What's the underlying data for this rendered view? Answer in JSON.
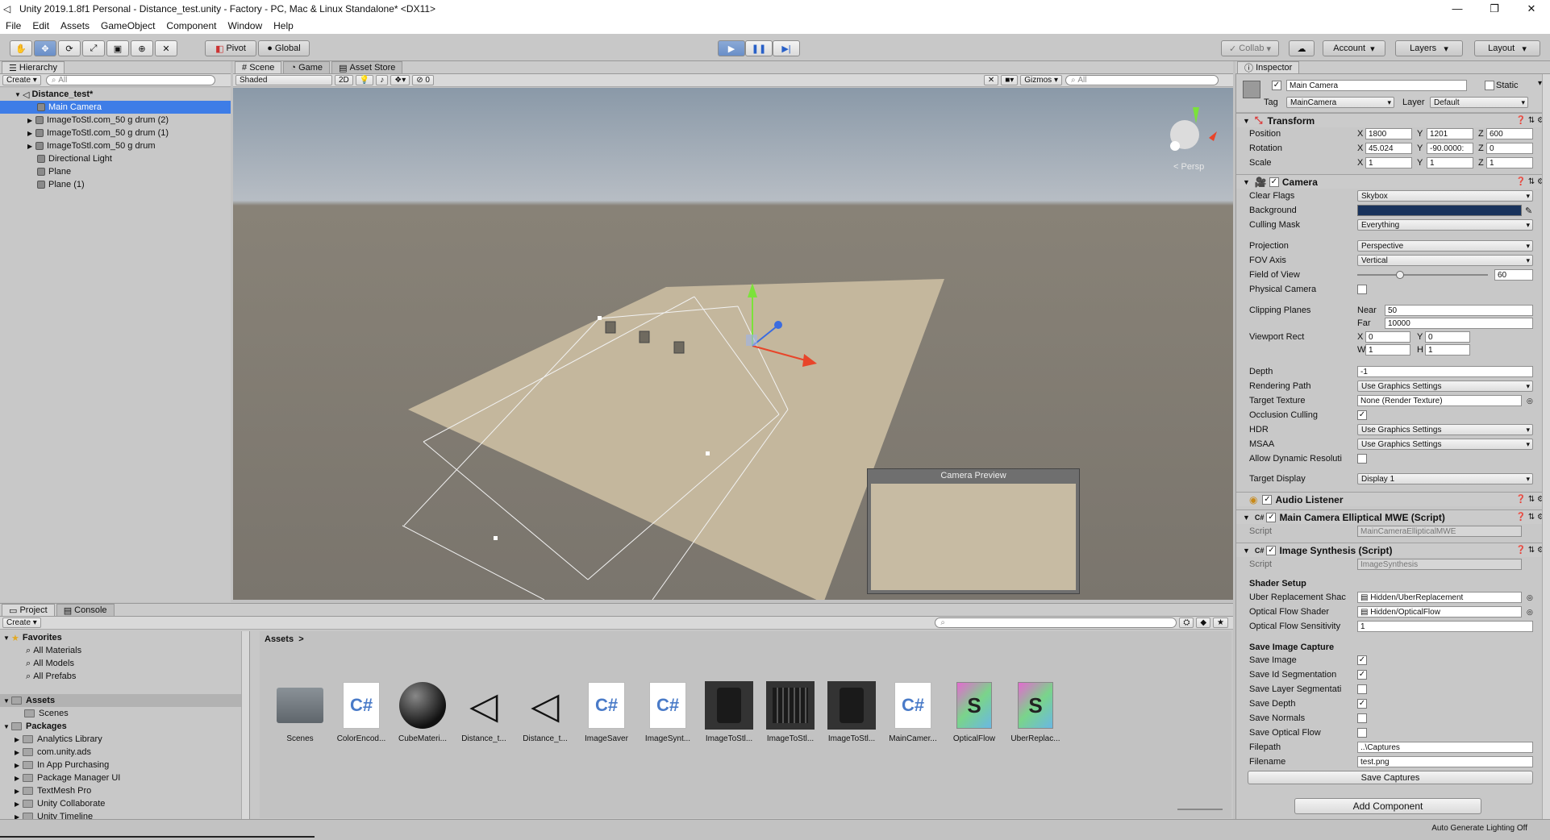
{
  "window": {
    "title": "Unity 2019.1.8f1 Personal - Distance_test.unity - Factory - PC, Mac & Linux Standalone* <DX11>",
    "controls": [
      "—",
      "❐",
      "✕"
    ]
  },
  "menu": [
    "File",
    "Edit",
    "Assets",
    "GameObject",
    "Component",
    "Window",
    "Help"
  ],
  "toolbar": {
    "pivot": "Pivot",
    "global": "Global",
    "collab": "Collab",
    "account": "Account",
    "layers": "Layers",
    "layout": "Layout"
  },
  "hierarchy": {
    "tab": "Hierarchy",
    "create": "Create",
    "search_placeholder": "All",
    "scene_name": "Distance_test*",
    "items": [
      {
        "label": "Main Camera",
        "selected": true,
        "expandable": false
      },
      {
        "label": "ImageToStl.com_50 g drum (2)",
        "selected": false,
        "expandable": true
      },
      {
        "label": "ImageToStl.com_50 g drum (1)",
        "selected": false,
        "expandable": true
      },
      {
        "label": "ImageToStl.com_50 g drum",
        "selected": false,
        "expandable": true
      },
      {
        "label": "Directional Light",
        "selected": false,
        "expandable": false
      },
      {
        "label": "Plane",
        "selected": false,
        "expandable": false
      },
      {
        "label": "Plane (1)",
        "selected": false,
        "expandable": false
      }
    ]
  },
  "scene": {
    "tabs": [
      "Scene",
      "Game",
      "Asset Store"
    ],
    "shading": "Shaded",
    "mode_2d": "2D",
    "fx_count": "0",
    "gizmos": "Gizmos",
    "search_placeholder": "All",
    "persp": "< Persp",
    "camera_preview": "Camera Preview"
  },
  "inspector": {
    "tab": "Inspector",
    "object_name": "Main Camera",
    "static_label": "Static",
    "tag_label": "Tag",
    "tag_value": "MainCamera",
    "layer_label": "Layer",
    "layer_value": "Default",
    "transform": {
      "title": "Transform",
      "position_label": "Position",
      "position": [
        "1800",
        "1201",
        "600"
      ],
      "rotation_label": "Rotation",
      "rotation": [
        "45.024",
        "-90.0000:",
        "0"
      ],
      "scale_label": "Scale",
      "scale": [
        "1",
        "1",
        "1"
      ]
    },
    "camera": {
      "title": "Camera",
      "clear_flags_label": "Clear Flags",
      "clear_flags": "Skybox",
      "background_label": "Background",
      "culling_mask_label": "Culling Mask",
      "culling_mask": "Everything",
      "projection_label": "Projection",
      "projection": "Perspective",
      "fov_axis_label": "FOV Axis",
      "fov_axis": "Vertical",
      "fov_label": "Field of View",
      "fov": "60",
      "fov_slider": 0.33,
      "physical_label": "Physical Camera",
      "clipping_label": "Clipping Planes",
      "near_label": "Near",
      "near": "50",
      "far_label": "Far",
      "far": "10000",
      "viewport_label": "Viewport Rect",
      "vx": "0",
      "vy": "0",
      "vw": "1",
      "vh": "1",
      "depth_label": "Depth",
      "depth": "-1",
      "rendering_path_label": "Rendering Path",
      "rendering_path": "Use Graphics Settings",
      "target_texture_label": "Target Texture",
      "target_texture": "None (Render Texture)",
      "occlusion_label": "Occlusion Culling",
      "hdr_label": "HDR",
      "hdr": "Use Graphics Settings",
      "msaa_label": "MSAA",
      "msaa": "Use Graphics Settings",
      "dyn_res_label": "Allow Dynamic Resoluti",
      "target_display_label": "Target Display",
      "target_display": "Display 1"
    },
    "audio_listener": "Audio Listener",
    "elliptical": {
      "title": "Main Camera Elliptical MWE (Script)",
      "script_label": "Script",
      "script": "MainCameraEllipticalMWE"
    },
    "synthesis": {
      "title": "Image Synthesis (Script)",
      "script_label": "Script",
      "script": "ImageSynthesis",
      "shader_setup": "Shader Setup",
      "uber_label": "Uber Replacement Shac",
      "uber": "Hidden/UberReplacement",
      "optical_label": "Optical Flow Shader",
      "optical": "Hidden/OpticalFlow",
      "sensitivity_label": "Optical Flow Sensitivity",
      "sensitivity": "1",
      "capture": "Save Image Capture",
      "save_image": "Save Image",
      "save_id": "Save Id Segmentation",
      "save_layer": "Save Layer Segmentati",
      "save_depth": "Save Depth",
      "save_normals": "Save Normals",
      "save_optical": "Save Optical Flow",
      "filepath_label": "Filepath",
      "filepath": "..\\Captures",
      "filename_label": "Filename",
      "filename": "test.png",
      "save_captures": "Save Captures"
    },
    "add_component": "Add Component"
  },
  "project": {
    "tabs": [
      "Project",
      "Console"
    ],
    "create": "Create",
    "favorites": "Favorites",
    "fav_items": [
      "All Materials",
      "All Models",
      "All Prefabs"
    ],
    "assets": "Assets",
    "asset_children": [
      "Scenes"
    ],
    "packages": "Packages",
    "package_items": [
      "Analytics Library",
      "com.unity.ads",
      "In App Purchasing",
      "Package Manager UI",
      "TextMesh Pro",
      "Unity Collaborate",
      "Unity Timeline"
    ],
    "breadcrumb": "Assets",
    "grid": [
      {
        "label": "Scenes",
        "kind": "folder"
      },
      {
        "label": "ColorEncod...",
        "kind": "cs"
      },
      {
        "label": "CubeMateri...",
        "kind": "sphere"
      },
      {
        "label": "Distance_t...",
        "kind": "unity"
      },
      {
        "label": "Distance_t...",
        "kind": "unity"
      },
      {
        "label": "ImageSaver",
        "kind": "cs"
      },
      {
        "label": "ImageSynt...",
        "kind": "cs"
      },
      {
        "label": "ImageToStl...",
        "kind": "drum"
      },
      {
        "label": "ImageToStl...",
        "kind": "crate"
      },
      {
        "label": "ImageToStl...",
        "kind": "drum"
      },
      {
        "label": "MainCamer...",
        "kind": "cs"
      },
      {
        "label": "OpticalFlow",
        "kind": "shader"
      },
      {
        "label": "UberReplac...",
        "kind": "shader"
      }
    ]
  },
  "status": {
    "right": "Auto Generate Lighting Off"
  },
  "colors": {
    "selection": "#3e7de7",
    "play_active": "#6a8fc8",
    "background_color": "#19335c"
  }
}
